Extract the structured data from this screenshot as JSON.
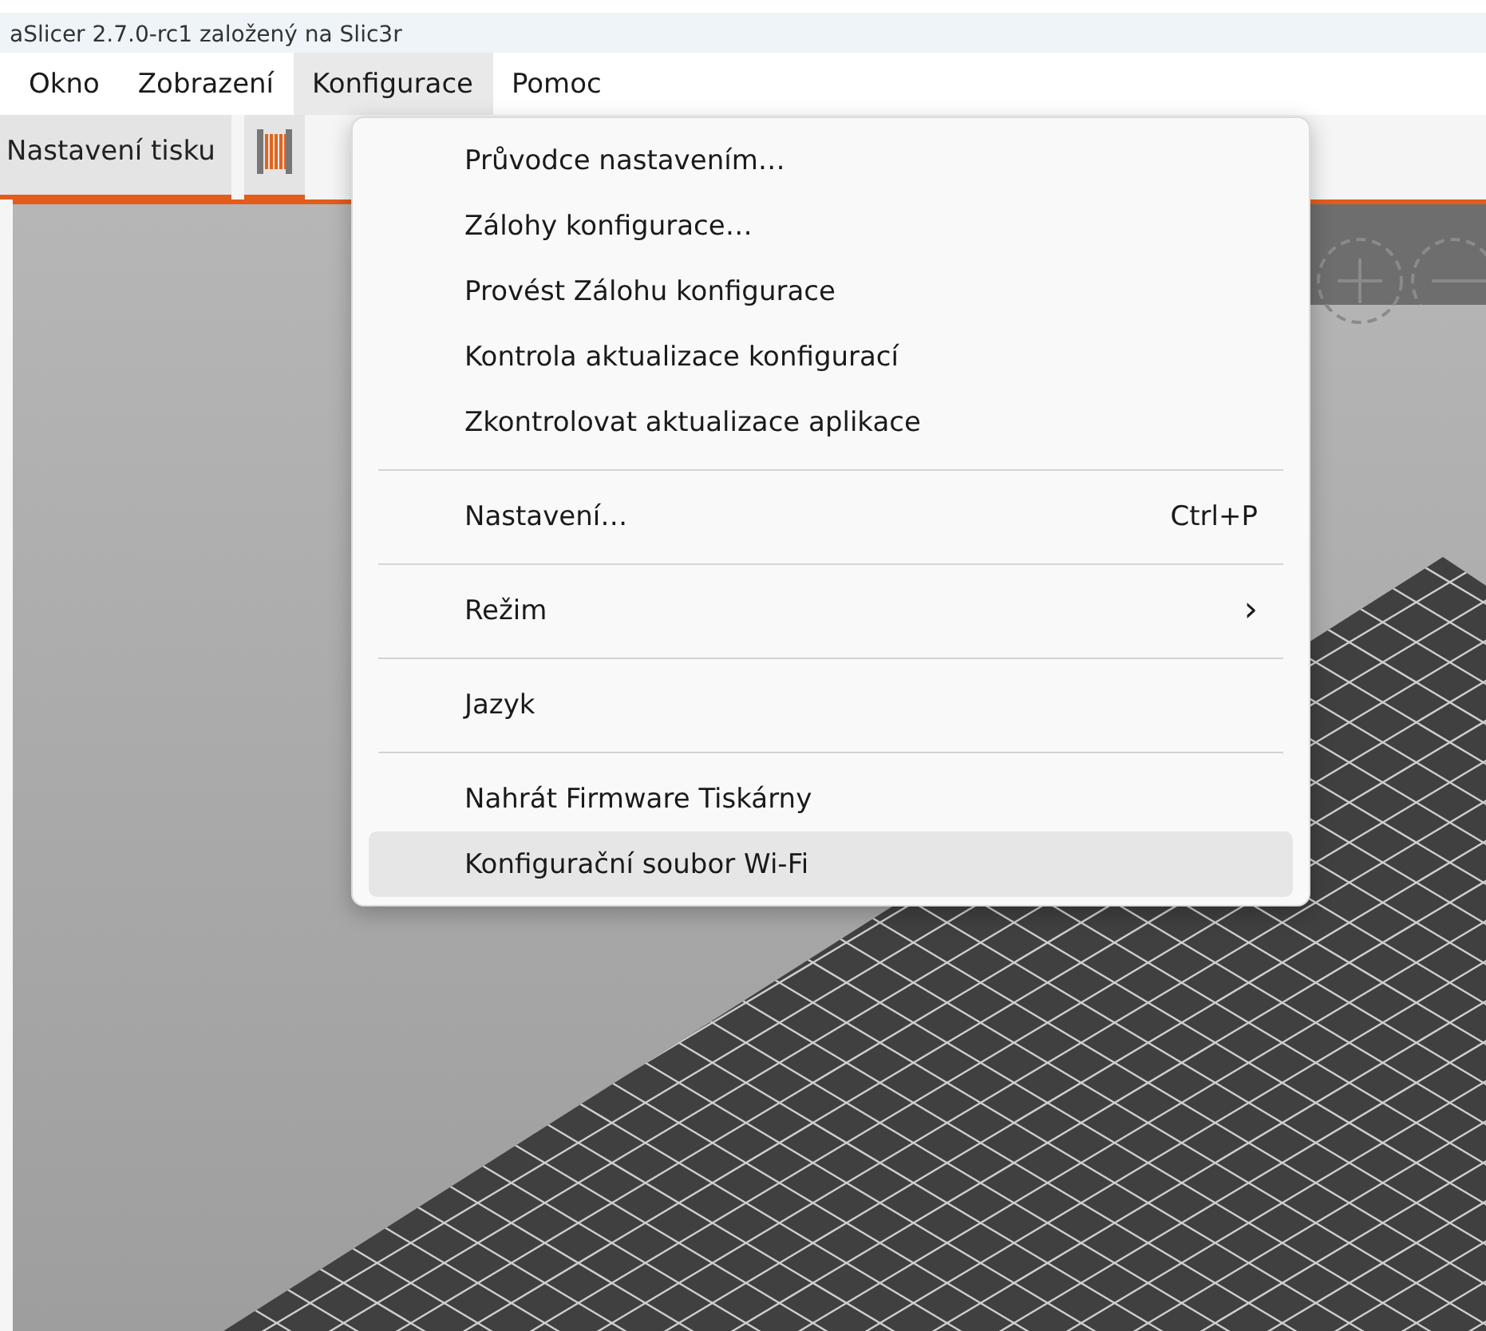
{
  "window": {
    "title": "aSlicer 2.7.0-rc1 založený na Slic3r"
  },
  "menubar": [
    {
      "label": "Okno",
      "selected": false
    },
    {
      "label": "Zobrazení",
      "selected": false
    },
    {
      "label": "Konfigurace",
      "selected": true
    },
    {
      "label": "Pomoc",
      "selected": false
    }
  ],
  "toolbar": {
    "tabs": [
      {
        "label": "Nastavení tisku",
        "kind": "text",
        "selected": false
      },
      {
        "kind": "filament",
        "selected": false
      }
    ]
  },
  "menu": {
    "items": [
      {
        "kind": "item",
        "label": "Průvodce nastavením…",
        "selected": false
      },
      {
        "kind": "item",
        "label": "Zálohy konfigurace…",
        "selected": false
      },
      {
        "kind": "item",
        "label": "Provést Zálohu konfigurace",
        "selected": false
      },
      {
        "kind": "item",
        "label": "Kontrola aktualizace konfigurací",
        "selected": false
      },
      {
        "kind": "item",
        "label": "Zkontrolovat aktualizace aplikace",
        "selected": false
      },
      {
        "kind": "separator"
      },
      {
        "kind": "item",
        "label": "Nastavení…",
        "shortcut": "Ctrl+P",
        "selected": false
      },
      {
        "kind": "separator"
      },
      {
        "kind": "submenu",
        "label": "Režim",
        "arrow": "›",
        "selected": false
      },
      {
        "kind": "separator"
      },
      {
        "kind": "item",
        "label": "Jazyk",
        "selected": false
      },
      {
        "kind": "separator"
      },
      {
        "kind": "item",
        "label": "Nahrát Firmware Tiskárny",
        "selected": false
      },
      {
        "kind": "item",
        "label": "Konfigurační soubor Wi-Fi",
        "selected": true
      }
    ]
  }
}
